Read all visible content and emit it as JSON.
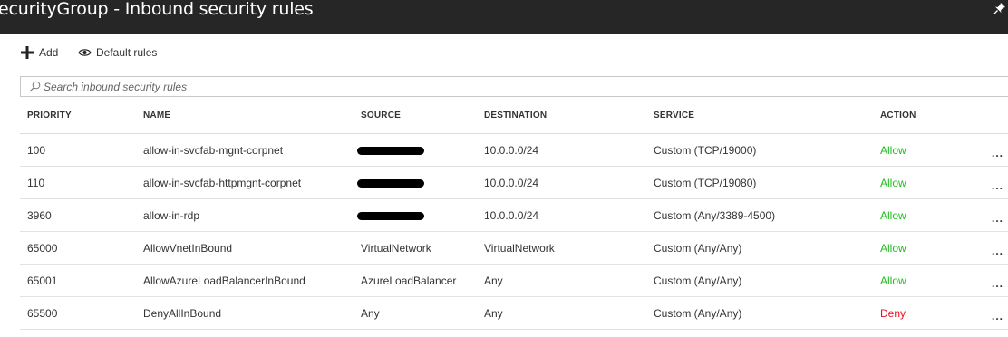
{
  "window": {
    "title": "ecurityGroup - Inbound security rules"
  },
  "toolbar": {
    "add_label": "Add",
    "default_rules_label": "Default rules"
  },
  "search": {
    "placeholder": "Search inbound security rules"
  },
  "table": {
    "columns": [
      "PRIORITY",
      "NAME",
      "SOURCE",
      "DESTINATION",
      "SERVICE",
      "ACTION"
    ],
    "rows": [
      {
        "priority": "100",
        "name": "allow-in-svcfab-mgnt-corpnet",
        "source": "",
        "destination": "10.0.0.0/24",
        "service": "Custom (TCP/19000)",
        "action": "Allow"
      },
      {
        "priority": "110",
        "name": "allow-in-svcfab-httpmgnt-corpnet",
        "source": "",
        "destination": "10.0.0.0/24",
        "service": "Custom (TCP/19080)",
        "action": "Allow"
      },
      {
        "priority": "3960",
        "name": "allow-in-rdp",
        "source": "",
        "destination": "10.0.0.0/24",
        "service": "Custom (Any/3389-4500)",
        "action": "Allow"
      },
      {
        "priority": "65000",
        "name": "AllowVnetInBound",
        "source": "VirtualNetwork",
        "destination": "VirtualNetwork",
        "service": "Custom (Any/Any)",
        "action": "Allow"
      },
      {
        "priority": "65001",
        "name": "AllowAzureLoadBalancerInBound",
        "source": "AzureLoadBalancer",
        "destination": "Any",
        "service": "Custom (Any/Any)",
        "action": "Allow"
      },
      {
        "priority": "65500",
        "name": "DenyAllInBound",
        "source": "Any",
        "destination": "Any",
        "service": "Custom (Any/Any)",
        "action": "Deny"
      }
    ],
    "more_label": "..."
  },
  "colors": {
    "titlebar_bg": "#262626",
    "allow": "#1fbd1f",
    "deny": "#e81123"
  },
  "icons": {
    "add": "plus-icon",
    "default_rules": "eye-icon",
    "search": "search-icon",
    "pin": "pin-icon"
  }
}
